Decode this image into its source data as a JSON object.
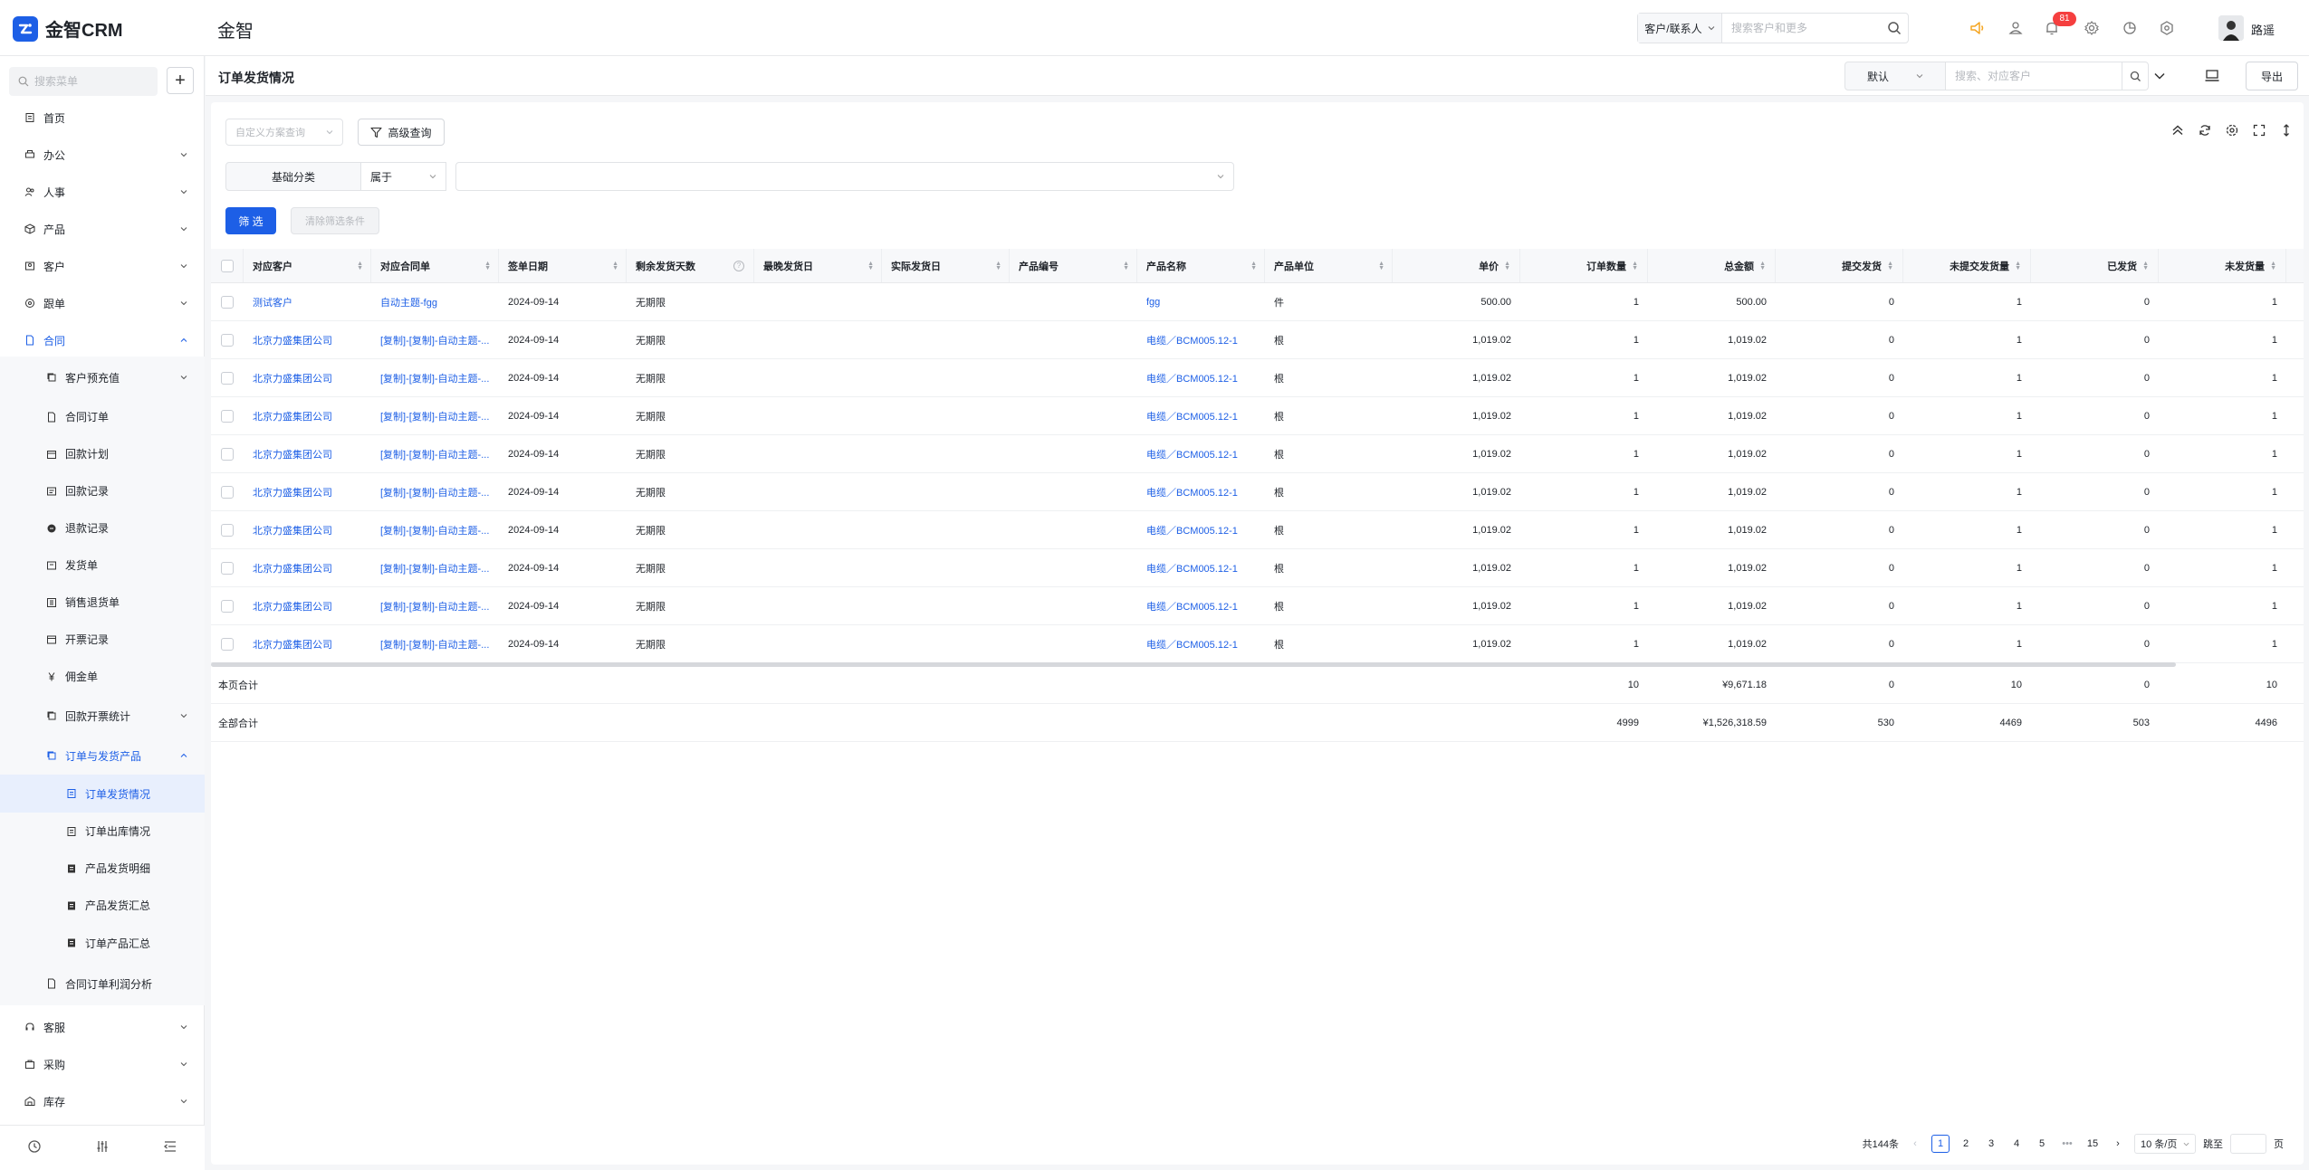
{
  "app": {
    "name": "金智CRM",
    "header_title": "金智"
  },
  "header": {
    "search_type": "客户/联系人",
    "search_placeholder": "搜索客户和更多",
    "notif_count": "81",
    "user_name": "路遥"
  },
  "sidebar": {
    "search_placeholder": "搜索菜单",
    "items": [
      {
        "label": "首页"
      },
      {
        "label": "办公"
      },
      {
        "label": "人事"
      },
      {
        "label": "产品"
      },
      {
        "label": "客户"
      },
      {
        "label": "跟单"
      },
      {
        "label": "合同"
      },
      {
        "label": "客户预充值"
      },
      {
        "label": "合同订单"
      },
      {
        "label": "回款计划"
      },
      {
        "label": "回款记录"
      },
      {
        "label": "退款记录"
      },
      {
        "label": "发货单"
      },
      {
        "label": "销售退货单"
      },
      {
        "label": "开票记录"
      },
      {
        "label": "佣金单"
      },
      {
        "label": "回款开票统计"
      },
      {
        "label": "订单与发货产品"
      },
      {
        "label": "订单发货情况"
      },
      {
        "label": "订单出库情况"
      },
      {
        "label": "产品发货明细"
      },
      {
        "label": "产品发货汇总"
      },
      {
        "label": "订单产品汇总"
      },
      {
        "label": "合同订单利润分析"
      },
      {
        "label": "客服"
      },
      {
        "label": "采购"
      },
      {
        "label": "库存"
      }
    ]
  },
  "subbar": {
    "title": "订单发货情况",
    "view_label": "默认",
    "search_placeholder": "搜索、对应客户",
    "export_label": "导出"
  },
  "filters": {
    "scheme_placeholder": "自定义方案查询",
    "advanced_label": "高级查询",
    "field_label": "基础分类",
    "operator_label": "属于",
    "filter_btn": "筛 选",
    "clear_btn": "清除筛选条件"
  },
  "table": {
    "columns": [
      "对应客户",
      "对应合同单",
      "签单日期",
      "剩余发货天数",
      "最晚发货日",
      "实际发货日",
      "产品编号",
      "产品名称",
      "产品单位",
      "单价",
      "订单数量",
      "总金额",
      "提交发货",
      "未提交发货量",
      "已发货",
      "未发货量"
    ],
    "rows": [
      [
        "测试客户",
        "自动主题-fgg",
        "2024-09-14",
        "无期限",
        "",
        "",
        "",
        "fgg",
        "件",
        "500.00",
        "1",
        "500.00",
        "0",
        "1",
        "0",
        "1"
      ],
      [
        "北京力盛集团公司",
        "[复制]-[复制]-自动主题-...",
        "2024-09-14",
        "无期限",
        "",
        "",
        "",
        "电缆／BCM005.12-1",
        "根",
        "1,019.02",
        "1",
        "1,019.02",
        "0",
        "1",
        "0",
        "1"
      ],
      [
        "北京力盛集团公司",
        "[复制]-[复制]-自动主题-...",
        "2024-09-14",
        "无期限",
        "",
        "",
        "",
        "电缆／BCM005.12-1",
        "根",
        "1,019.02",
        "1",
        "1,019.02",
        "0",
        "1",
        "0",
        "1"
      ],
      [
        "北京力盛集团公司",
        "[复制]-[复制]-自动主题-...",
        "2024-09-14",
        "无期限",
        "",
        "",
        "",
        "电缆／BCM005.12-1",
        "根",
        "1,019.02",
        "1",
        "1,019.02",
        "0",
        "1",
        "0",
        "1"
      ],
      [
        "北京力盛集团公司",
        "[复制]-[复制]-自动主题-...",
        "2024-09-14",
        "无期限",
        "",
        "",
        "",
        "电缆／BCM005.12-1",
        "根",
        "1,019.02",
        "1",
        "1,019.02",
        "0",
        "1",
        "0",
        "1"
      ],
      [
        "北京力盛集团公司",
        "[复制]-[复制]-自动主题-...",
        "2024-09-14",
        "无期限",
        "",
        "",
        "",
        "电缆／BCM005.12-1",
        "根",
        "1,019.02",
        "1",
        "1,019.02",
        "0",
        "1",
        "0",
        "1"
      ],
      [
        "北京力盛集团公司",
        "[复制]-[复制]-自动主题-...",
        "2024-09-14",
        "无期限",
        "",
        "",
        "",
        "电缆／BCM005.12-1",
        "根",
        "1,019.02",
        "1",
        "1,019.02",
        "0",
        "1",
        "0",
        "1"
      ],
      [
        "北京力盛集团公司",
        "[复制]-[复制]-自动主题-...",
        "2024-09-14",
        "无期限",
        "",
        "",
        "",
        "电缆／BCM005.12-1",
        "根",
        "1,019.02",
        "1",
        "1,019.02",
        "0",
        "1",
        "0",
        "1"
      ],
      [
        "北京力盛集团公司",
        "[复制]-[复制]-自动主题-...",
        "2024-09-14",
        "无期限",
        "",
        "",
        "",
        "电缆／BCM005.12-1",
        "根",
        "1,019.02",
        "1",
        "1,019.02",
        "0",
        "1",
        "0",
        "1"
      ],
      [
        "北京力盛集团公司",
        "[复制]-[复制]-自动主题-...",
        "2024-09-14",
        "无期限",
        "",
        "",
        "",
        "电缆／BCM005.12-1",
        "根",
        "1,019.02",
        "1",
        "1,019.02",
        "0",
        "1",
        "0",
        "1"
      ]
    ],
    "page_total": {
      "label": "本页合计",
      "qty": "10",
      "amount": "¥9,671.18",
      "submitted": "0",
      "unsubmitted": "10",
      "shipped": "0",
      "unshipped": "10"
    },
    "all_total": {
      "label": "全部合计",
      "qty": "4999",
      "amount": "¥1,526,318.59",
      "submitted": "530",
      "unsubmitted": "4469",
      "shipped": "503",
      "unshipped": "4496"
    }
  },
  "pagination": {
    "total": "共144条",
    "pages": [
      "1",
      "2",
      "3",
      "4",
      "5"
    ],
    "ellipsis": "•••",
    "last": "15",
    "page_size": "10 条/页",
    "jump_label": "跳至",
    "page_suffix": "页"
  },
  "colors": {
    "primary": "#1d5fe6",
    "badge": "#f53f3f",
    "horn": "#f5a623"
  }
}
